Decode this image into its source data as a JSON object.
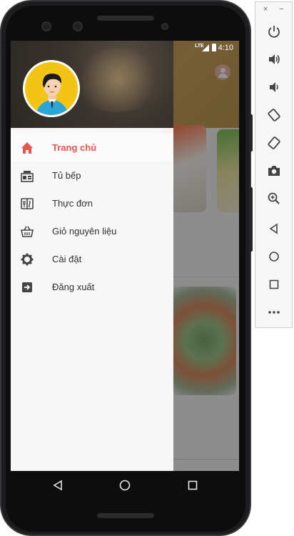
{
  "status_bar": {
    "network": "LTE",
    "time": "4:10"
  },
  "drawer": {
    "menu": [
      {
        "label": "Trang chủ",
        "icon": "home-icon",
        "active": true
      },
      {
        "label": "Tủ bếp",
        "icon": "kitchen-cabinet-icon",
        "active": false
      },
      {
        "label": "Thực đơn",
        "icon": "menu-book-icon",
        "active": false
      },
      {
        "label": "Giỏ nguyên liệu",
        "icon": "basket-icon",
        "active": false
      },
      {
        "label": "Cài đặt",
        "icon": "gear-icon",
        "active": false
      },
      {
        "label": "Đăng xuất",
        "icon": "logout-icon",
        "active": false
      }
    ]
  },
  "colors": {
    "accent": "#ef5350",
    "avatar_bg": "#f2c416"
  },
  "navigation": {
    "back": "back-icon",
    "home": "home-circle-icon",
    "recents": "recents-icon"
  },
  "emulator_toolbar": {
    "close": "×",
    "minimize": "−",
    "buttons": [
      "power-icon",
      "volume-up-icon",
      "volume-down-icon",
      "rotate-left-icon",
      "rotate-right-icon",
      "camera-icon",
      "zoom-icon",
      "back-icon",
      "home-icon",
      "overview-icon",
      "more-icon"
    ]
  }
}
